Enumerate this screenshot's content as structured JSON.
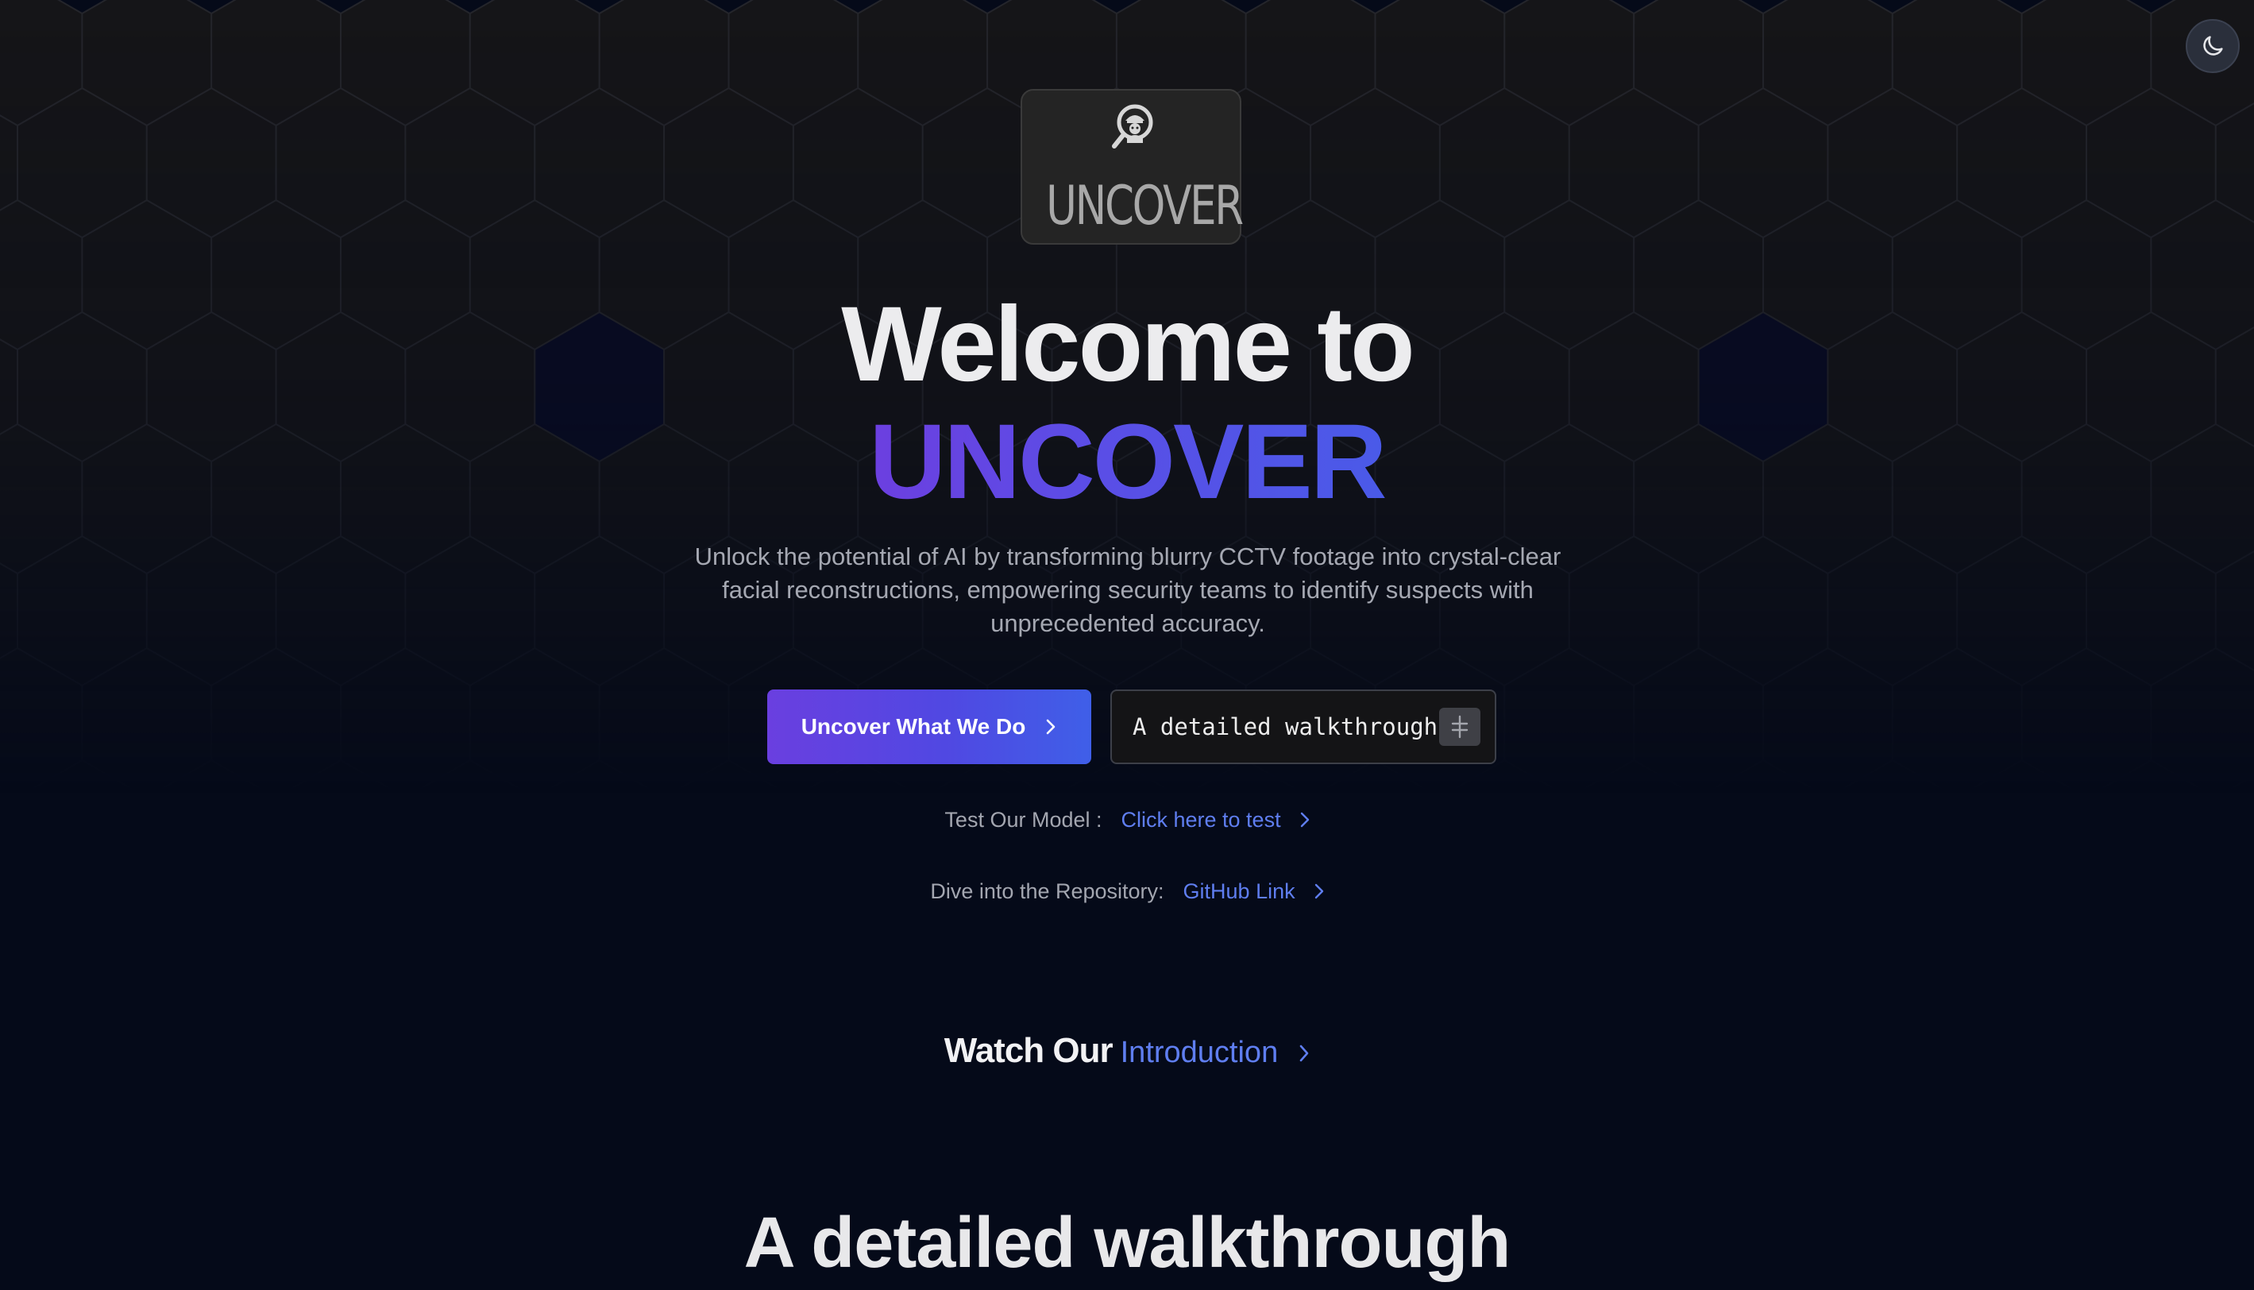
{
  "logo": {
    "text": "UNCOVER",
    "icon": "detective-magnifier-icon"
  },
  "theme_toggle": {
    "icon": "moon-icon"
  },
  "hero": {
    "title_line1": "Welcome to",
    "title_line2": "UNCOVER",
    "gradient_colors": [
      "#6c3fe0",
      "#4a5ae8"
    ],
    "subtitle": "Unlock the potential of AI by transforming blurry CCTV footage into crystal-clear facial reconstructions, empowering security teams to identify suspects with unprecedented accuracy."
  },
  "buttons": {
    "primary_label": "Uncover What We Do",
    "primary_icon": "chevron-right-icon",
    "secondary_label": "A detailed walkthrough",
    "secondary_icon": "copy-icon"
  },
  "test_model": {
    "label": "Test Our Model :",
    "link_text": "Click here to test"
  },
  "repository": {
    "label": "Dive into the Repository:",
    "link_text": "GitHub Link"
  },
  "watch": {
    "prefix": "Watch Our",
    "link_text": "Introduction"
  },
  "section": {
    "title": "A detailed walkthrough"
  },
  "colors": {
    "background": "#050a19",
    "accent_link": "#5f7ef0",
    "button_gradient_start": "#6a3fe0",
    "button_gradient_end": "#3f5fe8"
  }
}
